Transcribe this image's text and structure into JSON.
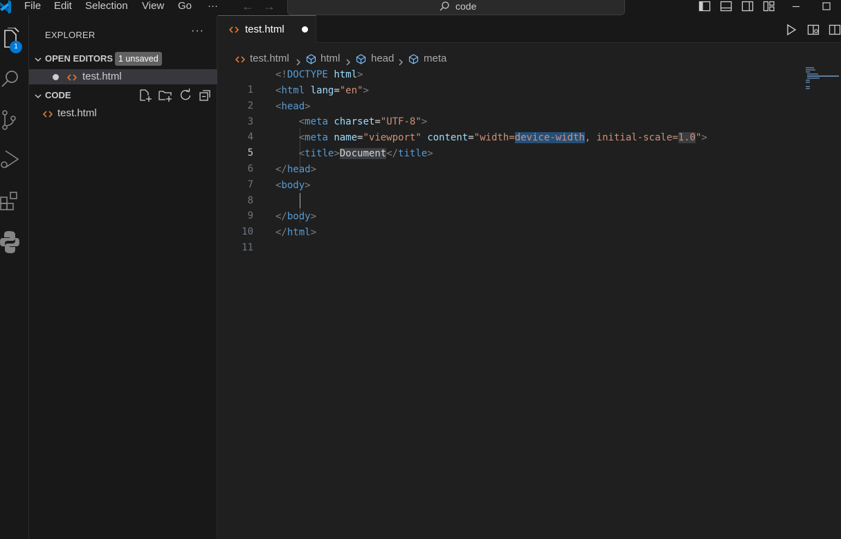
{
  "titlebar": {
    "menu": [
      "File",
      "Edit",
      "Selection",
      "View",
      "Go"
    ],
    "menu_more": "···",
    "search_text": "code"
  },
  "activity": {
    "explorer_badge": "1",
    "items": [
      "files-icon",
      "search-icon",
      "source-control-icon",
      "run-debug-icon",
      "extensions-icon",
      "python-icon"
    ]
  },
  "sidebar": {
    "title": "EXPLORER",
    "more": "···",
    "open_editors_label": "OPEN EDITORS",
    "unsaved_badge": "1 unsaved",
    "open_editor_file": "test.html",
    "folder_label": "CODE",
    "folder_file": "test.html"
  },
  "editor": {
    "tab_label": "test.html",
    "breadcrumb": [
      "test.html",
      "html",
      "head",
      "meta"
    ],
    "lines": [
      {
        "n": "1"
      },
      {
        "n": "2"
      },
      {
        "n": "3"
      },
      {
        "n": "4"
      },
      {
        "n": "5"
      },
      {
        "n": "6"
      },
      {
        "n": "7"
      },
      {
        "n": "8"
      },
      {
        "n": "9"
      },
      {
        "n": "10"
      },
      {
        "n": "11"
      }
    ],
    "active_line": "5",
    "code": {
      "l1": {
        "open": "<!",
        "kw": "DOCTYPE",
        "sp": " ",
        "attr": "html",
        "close": ">"
      },
      "l2": {
        "open": "<",
        "tag": "html",
        "sp": " ",
        "attr": "lang",
        "eq": "=",
        "val": "\"en\"",
        "close": ">"
      },
      "l3": {
        "open": "<",
        "tag": "head",
        "close": ">"
      },
      "l4": {
        "indent": "    ",
        "open": "<",
        "tag": "meta",
        "sp": " ",
        "attr": "charset",
        "eq": "=",
        "val": "\"UTF-8\"",
        "close": ">"
      },
      "l5": {
        "indent": "    ",
        "open": "<",
        "tag": "meta",
        "sp1": " ",
        "attr1": "name",
        "eq1": "=",
        "val1": "\"viewport\"",
        "sp2": " ",
        "attr2": "content",
        "eq2": "=",
        "val2a": "\"width=",
        "val2sel": "device-width",
        "val2b": ", initial-scale=",
        "val2num": "1.0",
        "val2c": "\"",
        "close": ">"
      },
      "l6": {
        "indent": "    ",
        "open": "<",
        "tag": "title",
        "close": ">",
        "text": "Document",
        "open2": "</",
        "tag2": "title",
        "close2": ">"
      },
      "l7": {
        "open": "</",
        "tag": "head",
        "close": ">"
      },
      "l8": {
        "open": "<",
        "tag": "body",
        "close": ">"
      },
      "l10": {
        "open": "</",
        "tag": "body",
        "close": ">"
      },
      "l11": {
        "open": "</",
        "tag": "html",
        "close": ">"
      }
    }
  },
  "colors": {
    "accent": "#0078d4",
    "html_icon": "#e37933",
    "tag_blue": "#569cd6",
    "attr": "#9cdcfe",
    "string": "#ce9178"
  }
}
